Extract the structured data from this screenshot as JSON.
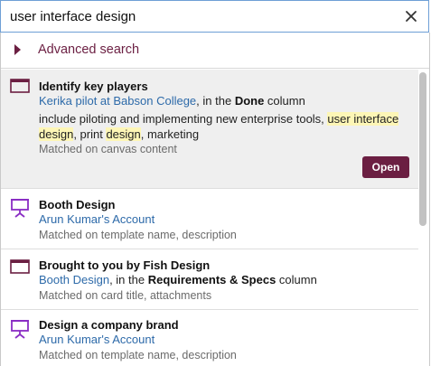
{
  "search": {
    "value": "user interface design",
    "clear_icon": "close-icon"
  },
  "advanced": {
    "label": "Advanced search",
    "icon": "triangle-right-icon"
  },
  "results": [
    {
      "icon": "card-icon",
      "title": "Identify key players",
      "sub_link": "Kerika pilot at Babson College",
      "sub_mid": ", in the ",
      "sub_bold": "Done",
      "sub_end": " column",
      "content_1": "include piloting and implementing new enterprise tools, ",
      "content_2": "user interface",
      "content_3": " ",
      "content_4": "design",
      "content_5": ", print ",
      "content_6": "design",
      "content_7": ", marketing",
      "match": "Matched on canvas content",
      "open_label": "Open"
    },
    {
      "icon": "template-icon",
      "title": "Booth Design",
      "sub_link": "Arun Kumar's Account",
      "match": "Matched on template name, description"
    },
    {
      "icon": "card-icon",
      "title": "Brought to you by Fish Design",
      "sub_link": "Booth Design",
      "sub_mid": ", in the ",
      "sub_bold": "Requirements & Specs",
      "sub_end": " column",
      "match": "Matched on card title, attachments"
    },
    {
      "icon": "template-icon",
      "title": "Design a company brand",
      "sub_link": "Arun Kumar's Account",
      "match": "Matched on template name, description"
    }
  ],
  "colors": {
    "accent": "#6b1f42",
    "link": "#2d6aa9",
    "highlight": "#fdf6b6",
    "template_icon": "#8a2ec4"
  }
}
